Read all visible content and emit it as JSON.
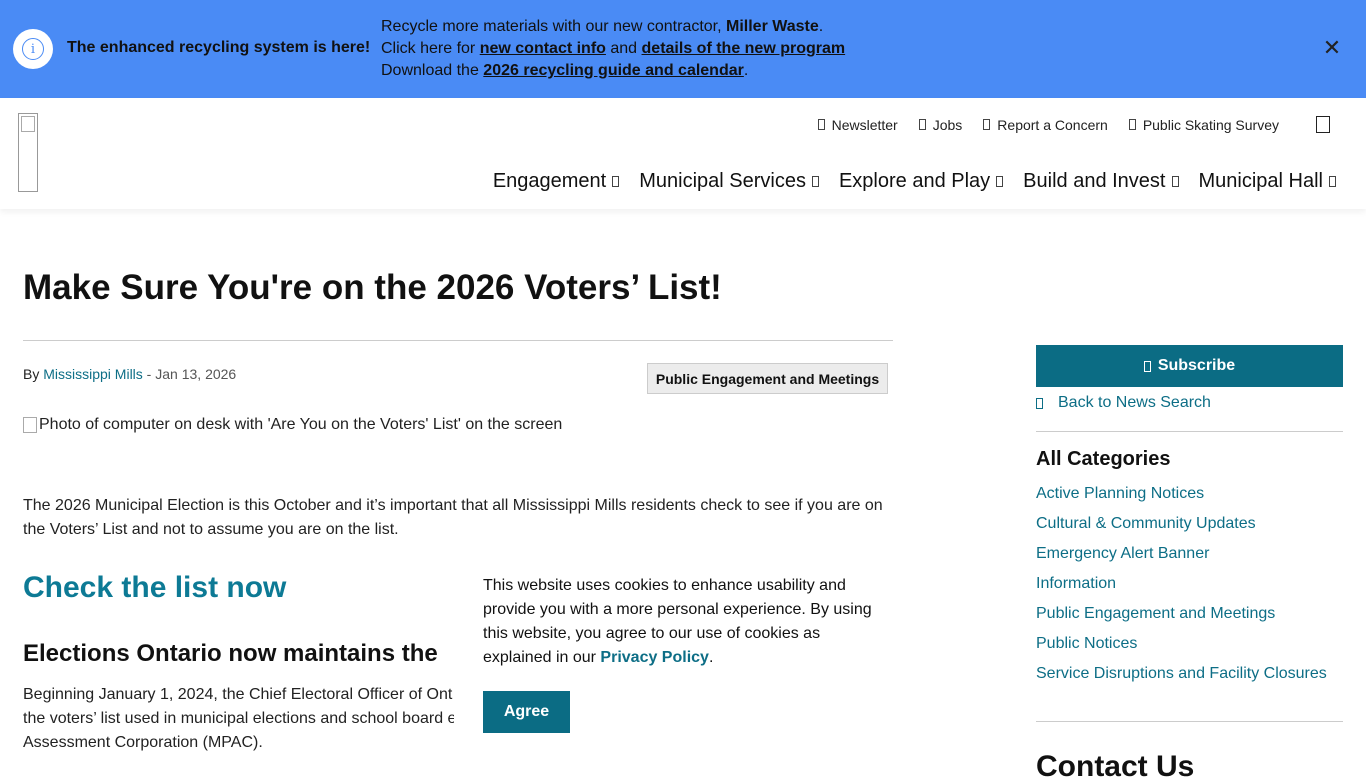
{
  "alert": {
    "headline": "The enhanced recycling system is here!",
    "line1_prefix": "Recycle more materials with our new contractor, ",
    "line1_bold": "Miller Waste",
    "line1_suffix": ".",
    "line2_prefix": "Click here for ",
    "line2_link1": "new contact info",
    "line2_mid": " and ",
    "line2_link2": "details of the new program",
    "line3_prefix": "Download the ",
    "line3_link": "2026 recycling guide and calendar",
    "line3_suffix": ".",
    "close_symbol": "✕",
    "info_symbol": "i",
    "background_color": "#4a8bf5"
  },
  "header": {
    "utility_nav": [
      {
        "label": "Newsletter"
      },
      {
        "label": "Jobs"
      },
      {
        "label": "Report a Concern"
      },
      {
        "label": "Public Skating Survey"
      }
    ],
    "main_nav": [
      {
        "label": "Engagement"
      },
      {
        "label": "Municipal Services"
      },
      {
        "label": "Explore and Play"
      },
      {
        "label": "Build and Invest"
      },
      {
        "label": "Municipal Hall"
      }
    ]
  },
  "article": {
    "title": "Make Sure You're on the 2026 Voters’ List!",
    "byline_prefix": "By ",
    "author": "Mississippi Mills",
    "date_sep": " - ",
    "date": "Jan 13, 2026",
    "category": "Public Engagement and Meetings",
    "image_alt": "Photo of computer on desk with 'Are You on the Voters' List' on the screen",
    "intro": "The 2026 Municipal Election is this October and it’s important that all Mississippi Mills residents check to see if you are on the Voters’ List and not to assume you are on the list.",
    "h2": "Check the list now",
    "h3": "Elections Ontario now maintains the",
    "para_line1": "Beginning January 1, 2024, the Chief Electoral Officer of Ont",
    "para_line2": "the voters’ list used in municipal elections and school board e",
    "para_line3": "Assessment Corporation (MPAC)."
  },
  "cookie": {
    "text": "This website uses cookies to enhance usability and provide you with a more personal experience. By using this website, you agree to our use of cookies as explained in our ",
    "link": "Privacy Policy",
    "suffix": ".",
    "button": "Agree"
  },
  "sidebar": {
    "subscribe_label": "Subscribe",
    "back_label": "Back to News Search",
    "categories_heading": "All Categories",
    "categories": [
      "Active Planning Notices",
      "Cultural & Community Updates",
      "Emergency Alert Banner",
      "Information",
      "Public Engagement and Meetings",
      "Public Notices",
      "Service Disruptions and Facility Closures"
    ],
    "contact_heading": "Contact Us"
  },
  "colors": {
    "accent": "#0b6c84",
    "link": "#0d6e86",
    "heading_teal": "#0d7a95"
  }
}
